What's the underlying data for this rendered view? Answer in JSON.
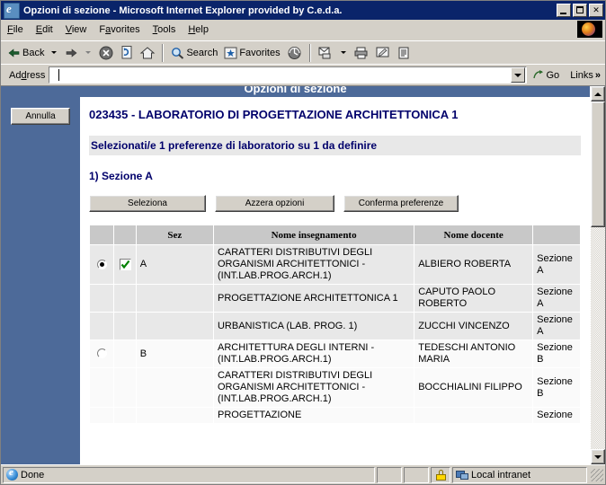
{
  "window": {
    "title": "Opzioni di sezione - Microsoft Internet Explorer provided by C.e.d.a.",
    "minimize_label": "_",
    "maximize_label": "□",
    "close_label": "X"
  },
  "menu": {
    "items": [
      {
        "label": "File",
        "accel": "F"
      },
      {
        "label": "Edit",
        "accel": "E"
      },
      {
        "label": "View",
        "accel": "V"
      },
      {
        "label": "Favorites",
        "accel": "a"
      },
      {
        "label": "Tools",
        "accel": "T"
      },
      {
        "label": "Help",
        "accel": "H"
      }
    ]
  },
  "toolbar": {
    "back_label": "Back",
    "forward_label": "",
    "stop_label": "",
    "refresh_label": "",
    "home_label": "",
    "search_label": "Search",
    "favorites_label": "Favorites",
    "history_label": "",
    "mail_label": "",
    "print_label": "",
    "edit_label": "",
    "discuss_label": ""
  },
  "address": {
    "label": "Address",
    "value": "",
    "placeholder": "",
    "go_label": "Go",
    "links_label": "Links",
    "chevron": "»"
  },
  "page": {
    "banner_title": "Opzioni di sezione",
    "cancel_button": "Annulla",
    "heading": "023435 - LABORATORIO DI PROGETTAZIONE ARCHITETTONICA 1",
    "highlight": "Selezionati/e 1 preferenze di laboratorio su 1 da definire",
    "subheading": "1) Sezione A",
    "buttons": {
      "select": "Seleziona",
      "reset": "Azzera opzioni",
      "confirm": "Conferma preferenze"
    },
    "table": {
      "headers": [
        "",
        "",
        "Sez",
        "Nome insegnamento",
        "Nome docente",
        ""
      ],
      "rows": [
        {
          "group": "a",
          "radio": "selected",
          "checkbox": "checked",
          "sez": "A",
          "insegnamento": "CARATTERI DISTRIBUTIVI DEGLI ORGANISMI ARCHITETTONICI - (INT.LAB.PROG.ARCH.1)",
          "docente": "ALBIERO ROBERTA",
          "sezione": "Sezione A"
        },
        {
          "group": "a",
          "radio": "none",
          "checkbox": "none",
          "sez": "",
          "insegnamento": "PROGETTAZIONE ARCHITETTONICA 1",
          "docente": "CAPUTO PAOLO ROBERTO",
          "sezione": "Sezione A"
        },
        {
          "group": "a",
          "radio": "none",
          "checkbox": "none",
          "sez": "",
          "insegnamento": "URBANISTICA (LAB. PROG. 1)",
          "docente": "ZUCCHI VINCENZO",
          "sezione": "Sezione A"
        },
        {
          "group": "b",
          "radio": "unselected",
          "checkbox": "none",
          "sez": "B",
          "insegnamento": "ARCHITETTURA DEGLI INTERNI - (INT.LAB.PROG.ARCH.1)",
          "docente": "TEDESCHI ANTONIO MARIA",
          "sezione": "Sezione B"
        },
        {
          "group": "b",
          "radio": "none",
          "checkbox": "none",
          "sez": "",
          "insegnamento": "CARATTERI DISTRIBUTIVI DEGLI ORGANISMI ARCHITETTONICI - (INT.LAB.PROG.ARCH.1)",
          "docente": "BOCCHIALINI FILIPPO",
          "sezione": "Sezione B"
        },
        {
          "group": "b",
          "radio": "none",
          "checkbox": "none",
          "sez": "",
          "insegnamento": "PROGETTAZIONE",
          "docente": "",
          "sezione": "Sezione"
        }
      ]
    }
  },
  "statusbar": {
    "text": "Done",
    "zone": "Local intranet"
  },
  "colors": {
    "titlebar": "#0a246a",
    "chrome": "#d4d0c8",
    "page_blue": "#4d6a99",
    "heading_navy": "#00006b",
    "highlight_bg": "#e8e8e8",
    "row_a_bg": "#e8e8e8",
    "row_b_bg": "#fafafa",
    "table_header_bg": "#c8c8c8",
    "check_green": "#008000"
  }
}
